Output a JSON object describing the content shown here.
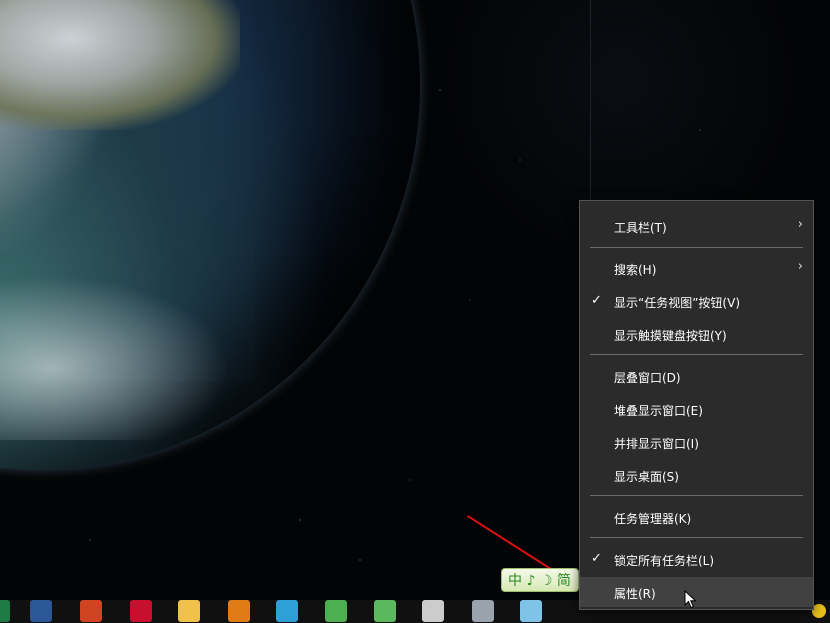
{
  "context_menu": {
    "items": [
      {
        "label": "工具栏(T)",
        "checked": false,
        "submenu": true
      },
      {
        "label": "搜索(H)",
        "checked": false,
        "submenu": true
      },
      {
        "label": "显示“任务视图”按钮(V)",
        "checked": true,
        "submenu": false
      },
      {
        "label": "显示触摸键盘按钮(Y)",
        "checked": false,
        "submenu": false
      },
      {
        "label": "层叠窗口(D)",
        "checked": false,
        "submenu": false
      },
      {
        "label": "堆叠显示窗口(E)",
        "checked": false,
        "submenu": false
      },
      {
        "label": "并排显示窗口(I)",
        "checked": false,
        "submenu": false
      },
      {
        "label": "显示桌面(S)",
        "checked": false,
        "submenu": false
      },
      {
        "label": "任务管理器(K)",
        "checked": false,
        "submenu": false
      },
      {
        "label": "锁定所有任务栏(L)",
        "checked": true,
        "submenu": false
      },
      {
        "label": "属性(R)",
        "checked": false,
        "submenu": false,
        "hovered": true
      }
    ],
    "check_glyph": "✓",
    "arrow_glyph": "›"
  },
  "ime_bar": {
    "text": "中 ♪ ☽ 简"
  },
  "taskbar": {
    "apps": [
      {
        "name": "excel-icon",
        "color": "#1e7b45"
      },
      {
        "name": "word-icon",
        "color": "#2b5797"
      },
      {
        "name": "powerpoint-icon",
        "color": "#d04423"
      },
      {
        "name": "autocad-icon",
        "color": "#c8102e"
      },
      {
        "name": "file-explorer-icon",
        "color": "#f0c24a"
      },
      {
        "name": "search-app-icon",
        "color": "#e07b16"
      },
      {
        "name": "telegram-icon",
        "color": "#2f9fd8"
      },
      {
        "name": "chrome-icon",
        "color": "#4caf50"
      },
      {
        "name": "browser-e-icon",
        "color": "#5cb85c"
      },
      {
        "name": "camera-app-icon",
        "color": "#cccccc"
      },
      {
        "name": "webcam-app-icon",
        "color": "#9aa3ad"
      },
      {
        "name": "notebook-app-icon",
        "color": "#7fc3e8"
      }
    ]
  }
}
